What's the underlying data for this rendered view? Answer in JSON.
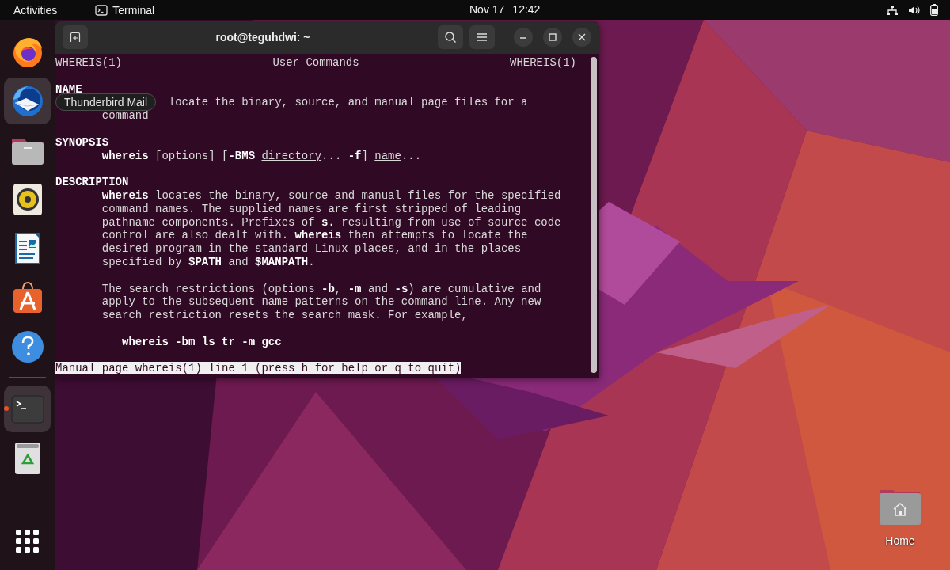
{
  "top_bar": {
    "activities": "Activities",
    "app_menu": "Terminal",
    "date": "Nov 17",
    "time": "12:42"
  },
  "dock": {
    "favorites": [
      {
        "kind": "browser",
        "highlighted": false,
        "running": false
      },
      {
        "kind": "mail",
        "highlighted": true,
        "running": false
      },
      {
        "kind": "files",
        "highlighted": false,
        "running": false
      },
      {
        "kind": "music",
        "highlighted": false,
        "running": false
      },
      {
        "kind": "document",
        "highlighted": false,
        "running": false
      },
      {
        "kind": "store",
        "highlighted": false,
        "running": false
      },
      {
        "kind": "help",
        "highlighted": false,
        "running": false
      }
    ],
    "others": [
      {
        "kind": "terminal",
        "highlighted": true,
        "running": true
      },
      {
        "kind": "trash",
        "highlighted": false,
        "running": false
      }
    ]
  },
  "tooltip": {
    "text": "Thunderbird Mail"
  },
  "window": {
    "title": "root@teguhdwi: ~",
    "lines": [
      {
        "kind": "header",
        "left": "WHEREIS(1)",
        "center": "User Commands",
        "right": "WHEREIS(1)"
      },
      {
        "kind": "blank"
      },
      {
        "kind": "heading",
        "segments": [
          {
            "kind": "bold",
            "text": "NAME"
          }
        ]
      },
      {
        "kind": "name-body",
        "segments": [
          {
            "kind": "plain",
            "text": "locate the binary, source, and manual page files for a"
          }
        ]
      },
      {
        "kind": "body",
        "segments": [
          {
            "kind": "plain",
            "text": "command"
          }
        ]
      },
      {
        "kind": "blank"
      },
      {
        "kind": "heading",
        "segments": [
          {
            "kind": "bold",
            "text": "SYNOPSIS"
          }
        ]
      },
      {
        "kind": "body",
        "segments": [
          {
            "kind": "bold",
            "text": "whereis"
          },
          {
            "kind": "plain",
            "text": " [options] ["
          },
          {
            "kind": "bold",
            "text": "-BMS "
          },
          {
            "kind": "underline",
            "text": "directory"
          },
          {
            "kind": "plain",
            "text": "... "
          },
          {
            "kind": "bold",
            "text": "-f"
          },
          {
            "kind": "plain",
            "text": "] "
          },
          {
            "kind": "underline",
            "text": "name"
          },
          {
            "kind": "plain",
            "text": "..."
          }
        ]
      },
      {
        "kind": "blank"
      },
      {
        "kind": "heading",
        "segments": [
          {
            "kind": "bold",
            "text": "DESCRIPTION"
          }
        ]
      },
      {
        "kind": "body",
        "segments": [
          {
            "kind": "bold",
            "text": "whereis"
          },
          {
            "kind": "plain",
            "text": " locates the binary, source and manual files for the specified"
          }
        ]
      },
      {
        "kind": "body",
        "segments": [
          {
            "kind": "plain",
            "text": "command names. The supplied names are first stripped of leading"
          }
        ]
      },
      {
        "kind": "body",
        "segments": [
          {
            "kind": "plain",
            "text": "pathname components. Prefixes of "
          },
          {
            "kind": "bold",
            "text": "s."
          },
          {
            "kind": "plain",
            "text": " resulting from use of source code"
          }
        ]
      },
      {
        "kind": "body",
        "segments": [
          {
            "kind": "plain",
            "text": "control are also dealt with. "
          },
          {
            "kind": "bold",
            "text": "whereis"
          },
          {
            "kind": "plain",
            "text": " then attempts to locate the"
          }
        ]
      },
      {
        "kind": "body",
        "segments": [
          {
            "kind": "plain",
            "text": "desired program in the standard Linux places, and in the places"
          }
        ]
      },
      {
        "kind": "body",
        "segments": [
          {
            "kind": "plain",
            "text": "specified by "
          },
          {
            "kind": "bold",
            "text": "$PATH"
          },
          {
            "kind": "plain",
            "text": " and "
          },
          {
            "kind": "bold",
            "text": "$MANPATH"
          },
          {
            "kind": "plain",
            "text": "."
          }
        ]
      },
      {
        "kind": "blank"
      },
      {
        "kind": "body",
        "segments": [
          {
            "kind": "plain",
            "text": "The search restrictions (options "
          },
          {
            "kind": "bold",
            "text": "-b"
          },
          {
            "kind": "plain",
            "text": ", "
          },
          {
            "kind": "bold",
            "text": "-m"
          },
          {
            "kind": "plain",
            "text": " and "
          },
          {
            "kind": "bold",
            "text": "-s"
          },
          {
            "kind": "plain",
            "text": ") are cumulative and"
          }
        ]
      },
      {
        "kind": "body",
        "segments": [
          {
            "kind": "plain",
            "text": "apply to the subsequent "
          },
          {
            "kind": "underline",
            "text": "name"
          },
          {
            "kind": "plain",
            "text": " patterns on the command line. Any new"
          }
        ]
      },
      {
        "kind": "body",
        "segments": [
          {
            "kind": "plain",
            "text": "search restriction resets the search mask. For example,"
          }
        ]
      },
      {
        "kind": "blank"
      },
      {
        "kind": "example",
        "segments": [
          {
            "kind": "bold",
            "text": "whereis -bm ls tr -m gcc"
          }
        ]
      },
      {
        "kind": "blank"
      }
    ],
    "status_line": "Manual page whereis(1) line 1 (press h for help or q to quit)"
  },
  "desktop_icons": [
    {
      "label": "Home"
    }
  ]
}
